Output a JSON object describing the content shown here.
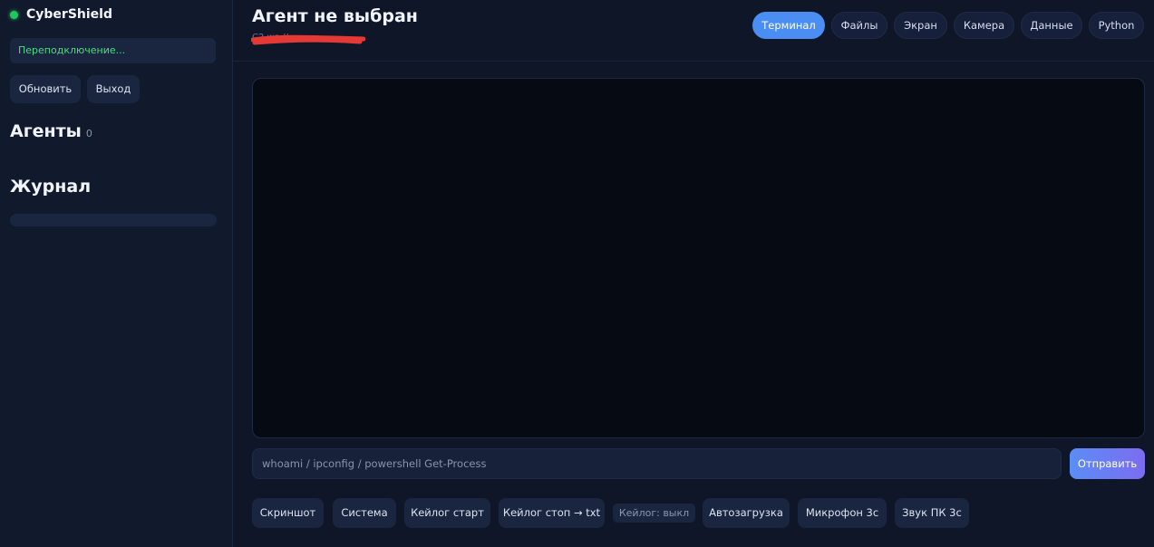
{
  "sidebar": {
    "brand": "CyberShield",
    "status": "Переподключение...",
    "refresh_label": "Обновить",
    "logout_label": "Выход",
    "agents_title": "Агенты",
    "agents_count": "0",
    "log_title": "Журнал"
  },
  "header": {
    "title": "Агент не выбран",
    "subtitle": "C2 ws://"
  },
  "tabs": [
    {
      "label": "Терминал"
    },
    {
      "label": "Файлы"
    },
    {
      "label": "Экран"
    },
    {
      "label": "Камера"
    },
    {
      "label": "Данные"
    },
    {
      "label": "Python"
    }
  ],
  "command": {
    "placeholder": "whoami / ipconfig / powershell Get-Process",
    "send_label": "Отправить"
  },
  "actions": {
    "screenshot": "Скриншот",
    "system": "Система",
    "keylog_start": "Кейлог старт",
    "keylog_stop": "Кейлог стоп → txt",
    "keylog_status": "Кейлог: выкл",
    "autostart": "Автозагрузка",
    "mic": "Микрофон 3с",
    "pc_sound": "Звук ПК 3с"
  },
  "colors": {
    "accent": "#4a8ef4",
    "status_ok": "#22c55e",
    "redaction": "#e53935"
  }
}
